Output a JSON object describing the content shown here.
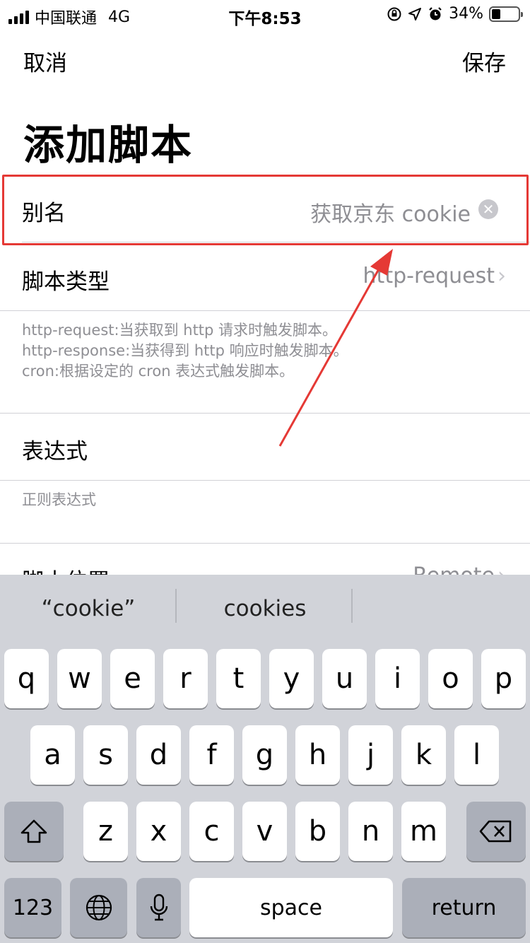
{
  "status_bar": {
    "carrier": "中国联通",
    "network": "4G",
    "time": "下午8:53",
    "battery": "34%",
    "battery_level": 0.34
  },
  "nav": {
    "cancel_label": "取消",
    "save_label": "保存"
  },
  "page_title": "添加脚本",
  "form": {
    "alias": {
      "label": "别名",
      "value": "获取京东 cookie"
    },
    "script_type": {
      "label": "脚本类型",
      "value": "http-request",
      "description": [
        "http-request:当获取到 http 请求时触发脚本。",
        "http-response:当获得到 http 响应时触发脚本。",
        "cron:根据设定的 cron 表达式触发脚本。"
      ]
    },
    "expression": {
      "label": "表达式",
      "hint": "正则表达式"
    },
    "script_location": {
      "label": "脚本位置",
      "value": "Remote"
    }
  },
  "keyboard": {
    "suggestions": [
      "“cookie”",
      "cookies",
      ""
    ],
    "row1": [
      "q",
      "w",
      "e",
      "r",
      "t",
      "y",
      "u",
      "i",
      "o",
      "p"
    ],
    "row2": [
      "a",
      "s",
      "d",
      "f",
      "g",
      "h",
      "j",
      "k",
      "l"
    ],
    "row3": [
      "z",
      "x",
      "c",
      "v",
      "b",
      "n",
      "m"
    ],
    "numbers_label": "123",
    "space_label": "space",
    "return_label": "return"
  },
  "colors": {
    "highlight": "#e53935",
    "annotation_arrow": "#e53935",
    "secondary_text": "#8e8e93"
  }
}
